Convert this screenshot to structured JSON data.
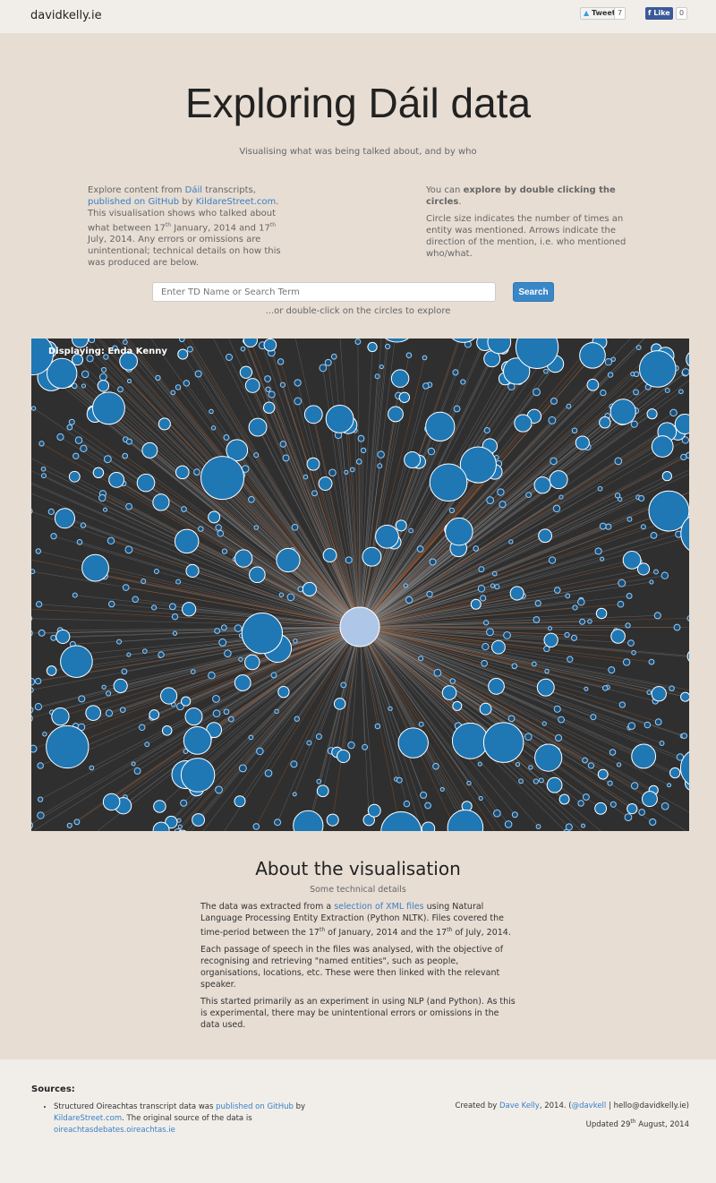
{
  "topbar": {
    "brand": "davidkelly.ie",
    "tweet_label": "Tweet",
    "tweet_count": "7",
    "like_label": "Like",
    "like_count": "0",
    "twitter_icon": "twitter-bird-icon",
    "facebook_icon": "facebook-f-icon"
  },
  "hero": {
    "title": "Exploring Dáil data",
    "subtitle": "Visualising what was being talked about, and by who"
  },
  "intro_left": {
    "t1": "Explore content from ",
    "l1": "Dáil",
    "t2": " transcripts, ",
    "l2": "published on GitHub",
    "t3": " by ",
    "l3": "KildareStreet.com",
    "t4": ". This visualisation shows who talked about what between 17",
    "s1": "th",
    "t5": " January, 2014 and 17",
    "s2": "th",
    "t6": " July, 2014. Any errors or omissions are unintentional; technical details on how this was produced are below."
  },
  "intro_right": {
    "t1": "You can ",
    "b1": "explore by double clicking the circles",
    "t2": ".",
    "p2": "Circle size indicates the number of times an entity was mentioned. Arrows indicate the direction of the mention, i.e. who mentioned who/what."
  },
  "search": {
    "placeholder": "Enter TD Name or Search Term",
    "button": "Search",
    "hint": "...or double-click on the circles to explore"
  },
  "viz": {
    "displaying": "Displaying: Enda Kenny",
    "colors": {
      "background": "#2f2f2f",
      "node": "#1f77b4",
      "center": "#aec7e8",
      "link": "#888888",
      "arrow": "#c8642a"
    }
  },
  "about": {
    "title": "About the visualisation",
    "subtitle": "Some technical details",
    "p1a": "The data was extracted from a ",
    "p1l": "selection of XML files",
    "p1b": " using Natural Language Processing Entity Extraction (Python NLTK). Files covered the time-period between the 17",
    "p1s1": "th",
    "p1c": " of January, 2014 and the 17",
    "p1s2": "th",
    "p1d": " of July, 2014.",
    "p2": "Each passage of speech in the files was analysed, with the objective of recognising and retrieving \"named entities\", such as people, organisations, locations, etc. These were then linked with the relevant speaker.",
    "p3": "This started primarily as an experiment in using NLP (and Python). As this is experimental, there may be unintentional errors or omissions in the data used."
  },
  "footer": {
    "sources_title": "Sources:",
    "s1": "Structured Oireachtas transcript data was ",
    "s1l1": "published on GitHub",
    "s2": " by ",
    "s1l2": "KildareStreet.com",
    "s3": ". The original source of the data is ",
    "s1l3": "oireachtasdebates.oireachtas.ie",
    "c1": "Created by ",
    "cl1": "Dave Kelly",
    "c2": ", 2014. (",
    "cl2": "@davkell",
    "c3": " | hello@davidkelly.ie)",
    "u1": "Updated 29",
    "us": "th",
    "u2": " August, 2014"
  }
}
